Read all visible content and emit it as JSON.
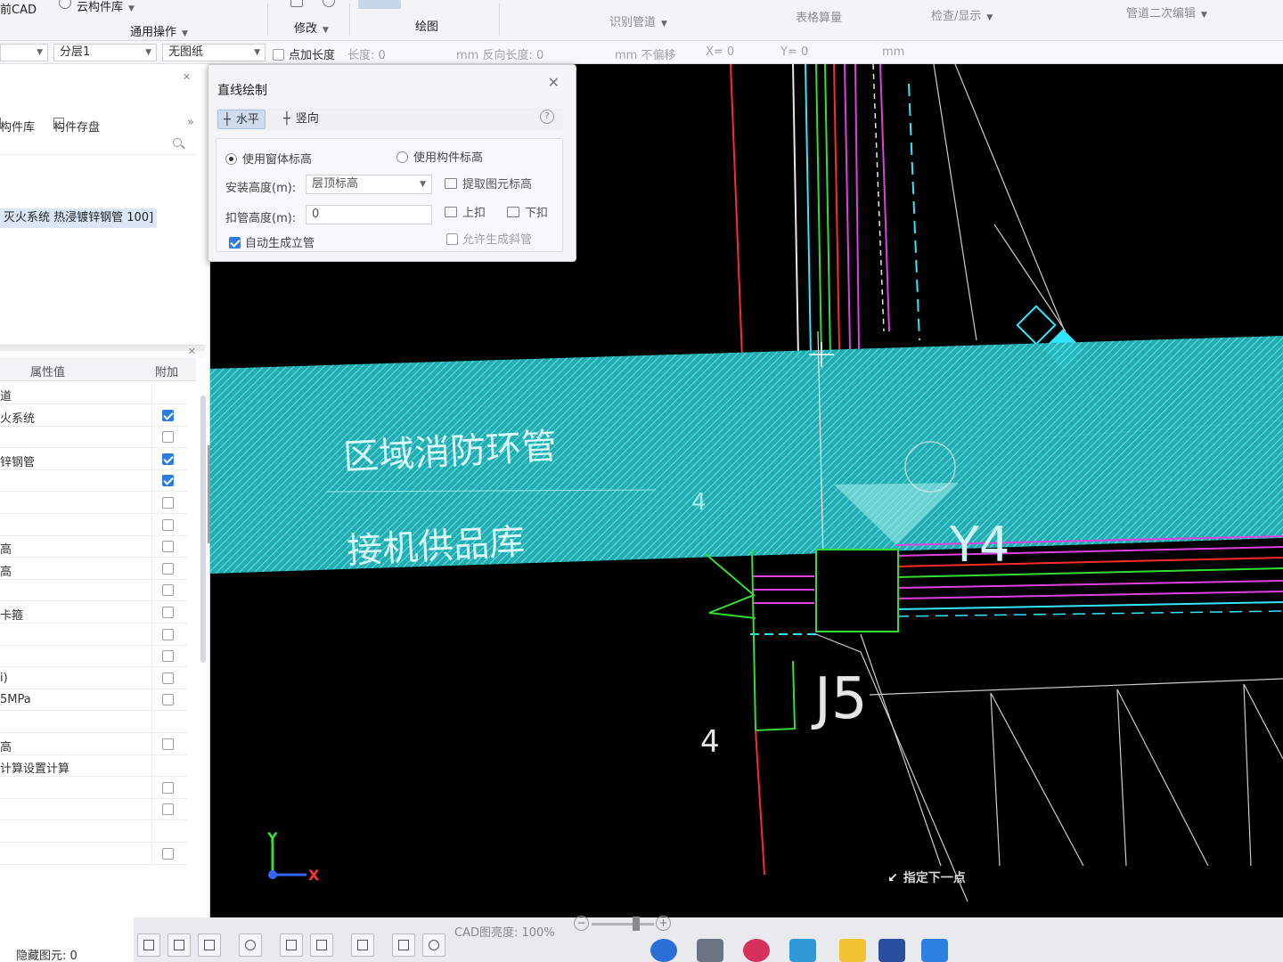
{
  "ribbon": {
    "app_cad": "前CAD",
    "cloud_lib": "云构件库",
    "general_ops": "通用操作",
    "modify": "修改",
    "draw": "绘图",
    "identify_pipe": "识别管道",
    "table_output": "表格算量",
    "check_display": "检查/显示",
    "pipe_edit": "管道二次编辑"
  },
  "optbar": {
    "combo1": "",
    "layer": "分层1",
    "drawing": "无图纸",
    "add_length_label": "点加长度",
    "length_label": "长度: 0",
    "mm_reverse": "mm  反向长度: 0",
    "mm_no_offset": "mm  不偏移",
    "x_label": "X= 0",
    "y_label": "Y= 0",
    "mm_end": "mm"
  },
  "left": {
    "tab_lib": "构件库",
    "tab_save": "构件存盘",
    "item_selected": "灭火系统 热浸镀锌钢管 100]",
    "props_header_value": "属性值",
    "props_header_extra": "附加",
    "rows": [
      {
        "value": "道",
        "checked": false,
        "show_cb": false
      },
      {
        "value": "火系统",
        "checked": true,
        "show_cb": true
      },
      {
        "value": "",
        "checked": false,
        "show_cb": true
      },
      {
        "value": "锌钢管",
        "checked": true,
        "show_cb": true
      },
      {
        "value": "",
        "checked": true,
        "show_cb": true
      },
      {
        "value": "",
        "checked": false,
        "show_cb": true
      },
      {
        "value": "",
        "checked": false,
        "show_cb": true
      },
      {
        "value": "高",
        "checked": false,
        "show_cb": true
      },
      {
        "value": "高",
        "checked": false,
        "show_cb": true
      },
      {
        "value": "",
        "checked": false,
        "show_cb": true
      },
      {
        "value": "卡箍",
        "checked": false,
        "show_cb": true
      },
      {
        "value": "",
        "checked": false,
        "show_cb": true
      },
      {
        "value": "",
        "checked": false,
        "show_cb": true
      },
      {
        "value": "i)",
        "checked": false,
        "show_cb": true
      },
      {
        "value": "5MPa",
        "checked": false,
        "show_cb": true
      },
      {
        "value": "",
        "checked": false,
        "show_cb": false
      },
      {
        "value": "高",
        "checked": false,
        "show_cb": true
      },
      {
        "value": "计算设置计算",
        "checked": false,
        "show_cb": false
      },
      {
        "value": "",
        "checked": false,
        "show_cb": true
      },
      {
        "value": "",
        "checked": false,
        "show_cb": true
      },
      {
        "value": "",
        "checked": false,
        "show_cb": false
      },
      {
        "value": "",
        "checked": false,
        "show_cb": true
      }
    ],
    "footer": "隐藏图元: 0"
  },
  "dialog": {
    "title": "直线绘制",
    "mode_horizontal": "水平",
    "mode_vertical": "竖向",
    "radio_body_elev": "使用窗体标高",
    "radio_comp_elev": "使用构件标高",
    "install_height_label": "安装高度(m):",
    "install_height_value": "层顶标高",
    "pick_elev": "提取图元标高",
    "bend_height_label": "扣管高度(m):",
    "bend_height_value": "0",
    "up_bend": "上扣",
    "down_bend": "下扣",
    "auto_riser": "自动生成立管",
    "allow_slope": "允许生成斜管"
  },
  "canvas": {
    "band_text_1": "区域消防环管",
    "band_text_2": "接机供品库",
    "label_4a": "4",
    "label_4b": "4",
    "label_J5": "J5",
    "label_Y4": "Y4",
    "axis_x": "X",
    "axis_y": "Y",
    "prompt": "指定下一点"
  },
  "status": {
    "cad_brightness": "CAD图亮度:  100%"
  },
  "colors": {
    "canvas_bg": "#000000",
    "band": "#2ec4c4",
    "red": "#ff2a2a",
    "green": "#33dd33",
    "cyan": "#33e6ff",
    "magenta": "#e040e0",
    "white": "#e6e6e6"
  }
}
